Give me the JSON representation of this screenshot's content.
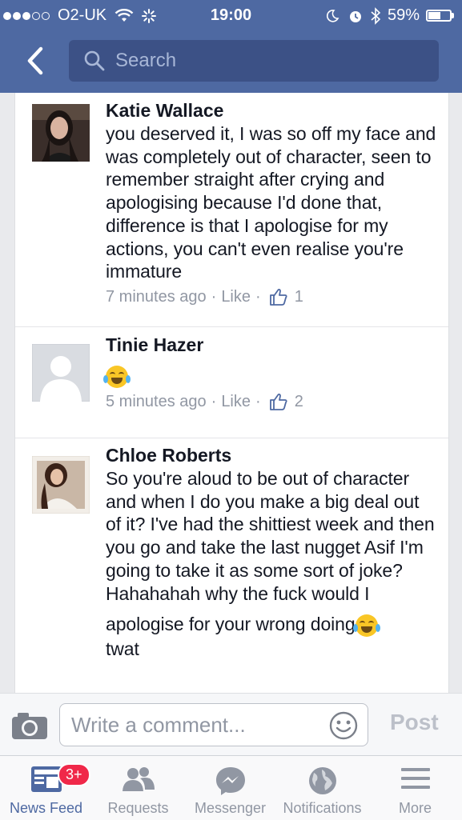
{
  "status_bar": {
    "carrier": "O2-UK",
    "time": "19:00",
    "battery_percent": "59%",
    "battery_level": 0.59
  },
  "search": {
    "placeholder": "Search"
  },
  "comments": [
    {
      "name": "Katie Wallace",
      "text": "you deserved it, I was so off my face and was completely out of character, seen to remember straight after crying and apologising because I'd done that, difference is that I apologise for my actions, you can't even realise you're immature",
      "time": "7 minutes ago",
      "like_label": "Like",
      "like_count": "1"
    },
    {
      "name": "Tinie Hazer",
      "text": "",
      "emoji": "face-with-tears-of-joy",
      "time": "5 minutes ago",
      "like_label": "Like",
      "like_count": "2"
    },
    {
      "name": "Chloe Roberts",
      "text": "So you're aloud to be out of character and when I do you make a big deal out of it? I've had the shittiest week and then you go and take the last nugget Asif I'm going to take it as some sort of joke? Hahahahah why the fuck would I",
      "text_2": "apologise for your wrong doing",
      "text_3": "twat"
    }
  ],
  "composer": {
    "placeholder": "Write a comment...",
    "post_label": "Post"
  },
  "tabs": [
    {
      "label": "News Feed",
      "icon": "news-feed-icon",
      "badge": "3+",
      "active": true
    },
    {
      "label": "Requests",
      "icon": "friend-requests-icon"
    },
    {
      "label": "Messenger",
      "icon": "messenger-icon"
    },
    {
      "label": "Notifications",
      "icon": "globe-icon"
    },
    {
      "label": "More",
      "icon": "menu-icon"
    }
  ],
  "colors": {
    "header": "#4e69a2",
    "search_bg": "#3c5186",
    "badge": "#f02849"
  }
}
